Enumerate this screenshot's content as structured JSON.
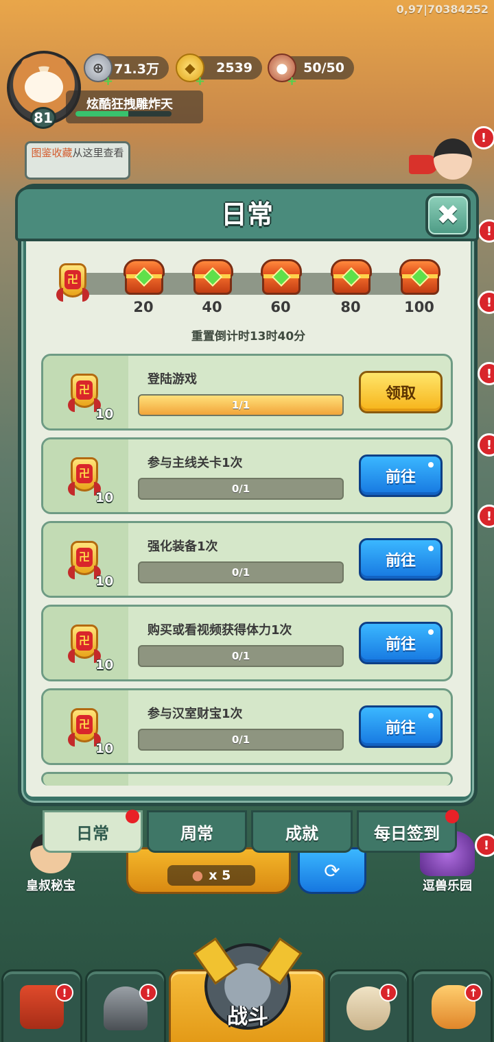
{
  "build_tag": "0,97|70384252",
  "player": {
    "level": "81",
    "name": "炫酷狂拽雕炸天",
    "exp_fraction": 0.55
  },
  "resources": {
    "coin": {
      "icon": "silver-coin-icon",
      "value": "71.3万"
    },
    "gold": {
      "icon": "gold-ingot-icon",
      "value": "2539"
    },
    "stamina": {
      "icon": "meat-drumstick-icon",
      "value": "50/50"
    }
  },
  "tip": {
    "highlight": "图鉴收藏",
    "text": "从这里查看"
  },
  "modal": {
    "title": "日常",
    "close_glyph": "✖",
    "reset_text": "重置倒计时13时40分",
    "milestones": [
      "20",
      "40",
      "60",
      "80",
      "100"
    ],
    "tasks": [
      {
        "name": "登陆游戏",
        "reward": "10",
        "progress": "1/1",
        "progress_fraction": 1.0,
        "button": "领取",
        "button_type": "claim"
      },
      {
        "name": "参与主线关卡1次",
        "reward": "10",
        "progress": "0/1",
        "progress_fraction": 0.0,
        "button": "前往",
        "button_type": "go"
      },
      {
        "name": "强化装备1次",
        "reward": "10",
        "progress": "0/1",
        "progress_fraction": 0.0,
        "button": "前往",
        "button_type": "go"
      },
      {
        "name": "购买或看视频获得体力1次",
        "reward": "10",
        "progress": "0/1",
        "progress_fraction": 0.0,
        "button": "前往",
        "button_type": "go"
      },
      {
        "name": "参与汉室财宝1次",
        "reward": "10",
        "progress": "0/1",
        "progress_fraction": 0.0,
        "button": "前往",
        "button_type": "go"
      }
    ],
    "tabs": [
      {
        "label": "日常",
        "active": true,
        "red_dot": true
      },
      {
        "label": "周常",
        "active": false,
        "red_dot": false
      },
      {
        "label": "成就",
        "active": false,
        "red_dot": false
      },
      {
        "label": "每日签到",
        "active": false,
        "red_dot": true
      }
    ]
  },
  "background": {
    "uncle_treasure_label": "皇叔秘宝",
    "beast_park_label": "逗兽乐园",
    "battle_cost": "x 5",
    "battle_label": "战斗"
  },
  "colors": {
    "accent_green": "#3a7367",
    "alert_red": "#d9252b",
    "claim_yellow": "#f6b319",
    "go_blue": "#1677e0"
  }
}
